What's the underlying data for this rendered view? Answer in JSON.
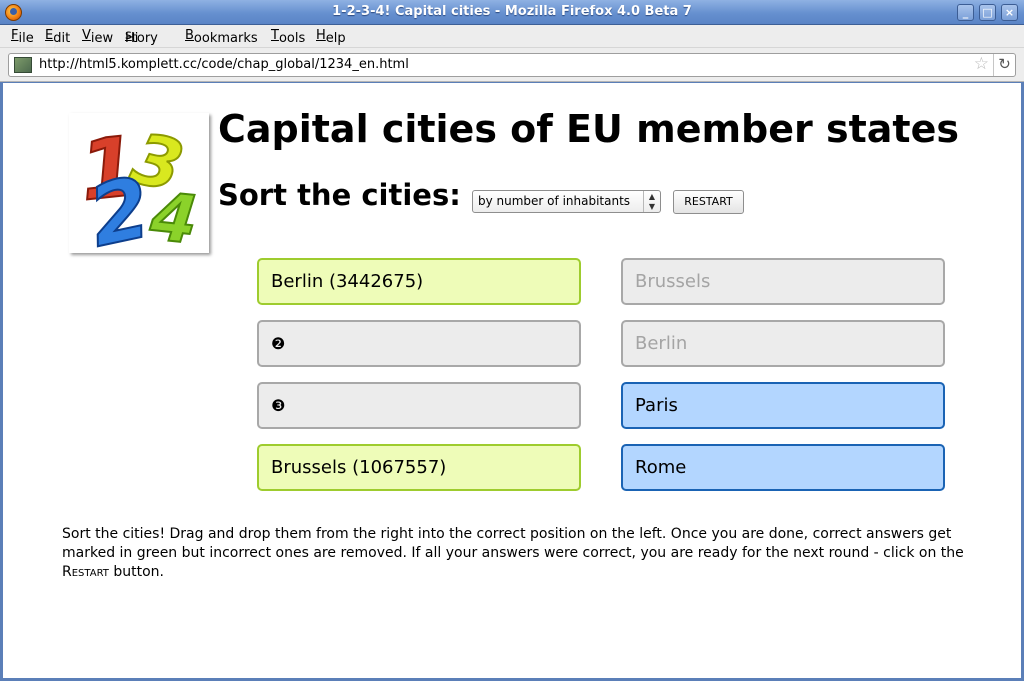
{
  "window": {
    "title": "1-2-3-4! Capital cities - Mozilla Firefox 4.0 Beta 7"
  },
  "menu": {
    "items": [
      {
        "pre": "",
        "u": "F",
        "post": "ile"
      },
      {
        "pre": "",
        "u": "E",
        "post": "dit"
      },
      {
        "pre": "",
        "u": "V",
        "post": "iew"
      },
      {
        "pre": "Hi",
        "u": "s",
        "post": "tory"
      },
      {
        "pre": "",
        "u": "B",
        "post": "ookmarks"
      },
      {
        "pre": "",
        "u": "T",
        "post": "ools"
      },
      {
        "pre": "",
        "u": "H",
        "post": "elp"
      }
    ]
  },
  "nav": {
    "url": "http://html5.komplett.cc/code/chap_global/1234_en.html"
  },
  "page": {
    "heading": "Capital cities of EU member states",
    "sort_label": "Sort the cities:",
    "sort_select_value": "by number of inhabitants",
    "restart_label": "RESTART",
    "answers": [
      {
        "text": "Berlin (3442675)",
        "state": "correct"
      },
      {
        "text": "❷",
        "state": "empty"
      },
      {
        "text": "❸",
        "state": "empty"
      },
      {
        "text": "Brussels (1067557)",
        "state": "correct"
      }
    ],
    "sources": [
      {
        "text": "Brussels",
        "state": "used"
      },
      {
        "text": "Berlin",
        "state": "used"
      },
      {
        "text": "Paris",
        "state": "available"
      },
      {
        "text": "Rome",
        "state": "available"
      }
    ],
    "instructions_before": "Sort the cities! Drag and drop them from the right into the correct position on the left. Once you are done, correct answers get marked in green but incorrect ones are removed. If all your answers were correct, you are ready for the next round - click on the ",
    "instructions_restart": "Restart",
    "instructions_after": " button.",
    "logo_digits": [
      "1",
      "2",
      "3",
      "4"
    ]
  },
  "colors": {
    "answer_correct_bg": "#eefcb8",
    "answer_correct_border": "#9ecc2e",
    "source_available_bg": "#b3d6ff",
    "source_available_border": "#1a63b4",
    "slot_empty_bg": "#ececec",
    "logo_1": "#d8402a",
    "logo_2": "#2f7ee0",
    "logo_3": "#d9e81f",
    "logo_4": "#8bd22a"
  }
}
